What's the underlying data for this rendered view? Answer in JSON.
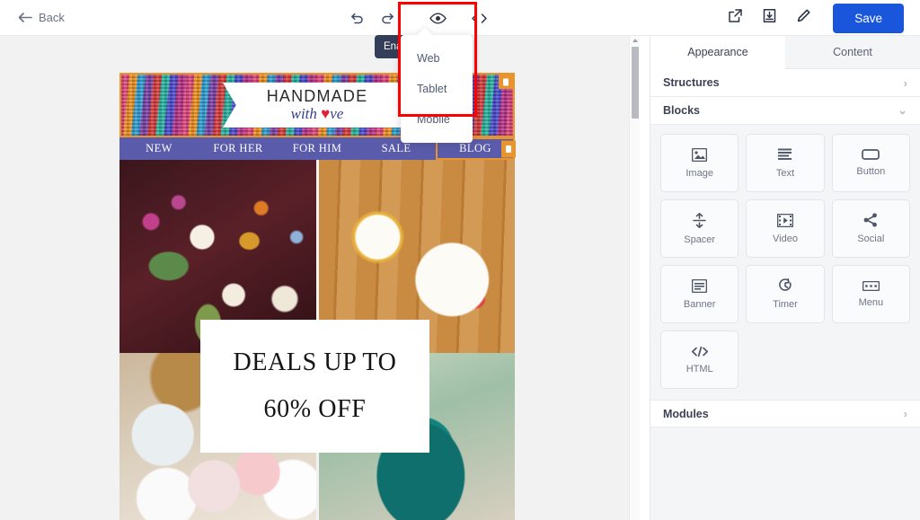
{
  "topbar": {
    "back_label": "Back",
    "save_label": "Save",
    "icons": {
      "back": "arrow-left-icon",
      "undo": "undo-icon",
      "redo": "redo-icon",
      "preview": "eye-icon",
      "code": "code-icon",
      "export": "external-link-icon",
      "download": "download-icon",
      "edit": "pencil-icon"
    }
  },
  "tooltip": {
    "text": "Ena"
  },
  "preview_dropdown": {
    "items": [
      {
        "label": "Web"
      },
      {
        "label": "Tablet"
      },
      {
        "label": "Mobile"
      }
    ]
  },
  "annotation": {
    "color": "#ff0000"
  },
  "email": {
    "banner": {
      "line1": "HANDMADE",
      "line2_pre": "with ",
      "line2_heart": "♥",
      "line2_post": "ve",
      "badge_icon": "block-handle-icon"
    },
    "nav": {
      "items": [
        {
          "label": "NEW",
          "selected": false
        },
        {
          "label": "FOR HER",
          "selected": false
        },
        {
          "label": "FOR HIM",
          "selected": false
        },
        {
          "label": "SALE",
          "selected": false
        },
        {
          "label": "BLOG",
          "selected": true
        }
      ],
      "background": "#5b5bab",
      "selected_outline": "#e8952e"
    },
    "images": [
      {
        "name": "embroidered-flowers-image"
      },
      {
        "name": "ceramic-mugs-image"
      },
      {
        "name": "fabric-hearts-image"
      },
      {
        "name": "teal-vase-image"
      }
    ],
    "promo": {
      "line1": "DEALS UP TO",
      "line2": "60% OFF"
    }
  },
  "panel": {
    "tabs": [
      {
        "label": "Appearance",
        "active": true
      },
      {
        "label": "Content",
        "active": false
      }
    ],
    "sections": {
      "structures": "Structures",
      "blocks": "Blocks",
      "modules": "Modules"
    },
    "blocks": [
      {
        "label": "Image",
        "icon": "image-icon"
      },
      {
        "label": "Text",
        "icon": "text-lines-icon"
      },
      {
        "label": "Button",
        "icon": "button-icon"
      },
      {
        "label": "Spacer",
        "icon": "spacer-icon"
      },
      {
        "label": "Video",
        "icon": "video-icon"
      },
      {
        "label": "Social",
        "icon": "share-icon"
      },
      {
        "label": "Banner",
        "icon": "banner-icon"
      },
      {
        "label": "Timer",
        "icon": "timer-icon"
      },
      {
        "label": "Menu",
        "icon": "menu-icon"
      },
      {
        "label": "HTML",
        "icon": "code-icon"
      }
    ]
  },
  "colors": {
    "accent": "#1a56db",
    "selection": "#e8952e",
    "nav": "#5b5bab"
  }
}
